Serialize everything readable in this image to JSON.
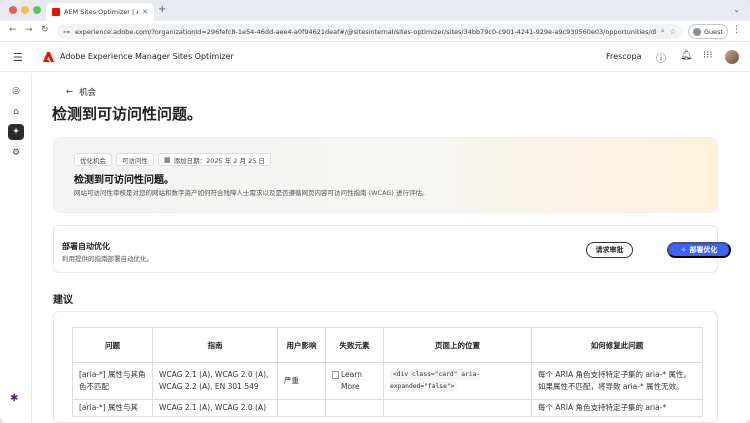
{
  "browser": {
    "tab_title": "AEM Sites Optimizer | Adob",
    "url": "experience.adobe.com/?organizationId=296fefc8-1e54-46dd-aee4-a0f94621deaf#/@sitesinternal/sites-optimizer/sites/34bb79c0-c901-4241-929e-a9c930560e03/opportunities/dbc0589",
    "guest_label": "Guest"
  },
  "app": {
    "title": "Adobe Experience Manager Sites Optimizer",
    "org": "Frescopa"
  },
  "page": {
    "back_label": "机会",
    "title": "检测到可访问性问题。"
  },
  "hero": {
    "tags": [
      "优化机会",
      "可访问性"
    ],
    "date_label": "添加日期：2025 年 2 月 25 日",
    "title": "检测到可访问性问题。",
    "description": "网站可访问性审核是对您的网站和数字资产如何符合残障人士需求以及是否遵循网页内容可访问性指南 (WCAG) 进行评估。"
  },
  "deploy": {
    "title": "部署自动优化",
    "description": "利用提供的指南部署自动优化。",
    "request_approval": "请求审批",
    "deploy_button": "部署优化"
  },
  "recommendations": {
    "section_title": "建议",
    "headers": [
      "问题",
      "指南",
      "用户影响",
      "失败元素",
      "页面上的位置",
      "如何修复此问题"
    ],
    "rows": [
      {
        "issue": "[aria-*] 属性与其角色不匹配",
        "guideline": "WCAG 2.1 (A), WCAG 2.0 (A), WCAG 2.2 (A), EN 301 549",
        "impact": "严重",
        "failing_element": "Learn More",
        "location": "<div class=\"card\" aria-expanded=\"false\">",
        "fix": "每个 ARIA 角色支持特定子集的 aria-* 属性。如果属性不匹配，将导致 aria-* 属性无效。"
      },
      {
        "issue": "[aria-*] 属性与其",
        "guideline": "WCAG 2.1 (A), WCAG 2.0 (A)",
        "impact": "",
        "failing_element": "",
        "location": "",
        "fix": "每个 ARIA 角色支持特定子集的 aria-*"
      }
    ]
  }
}
